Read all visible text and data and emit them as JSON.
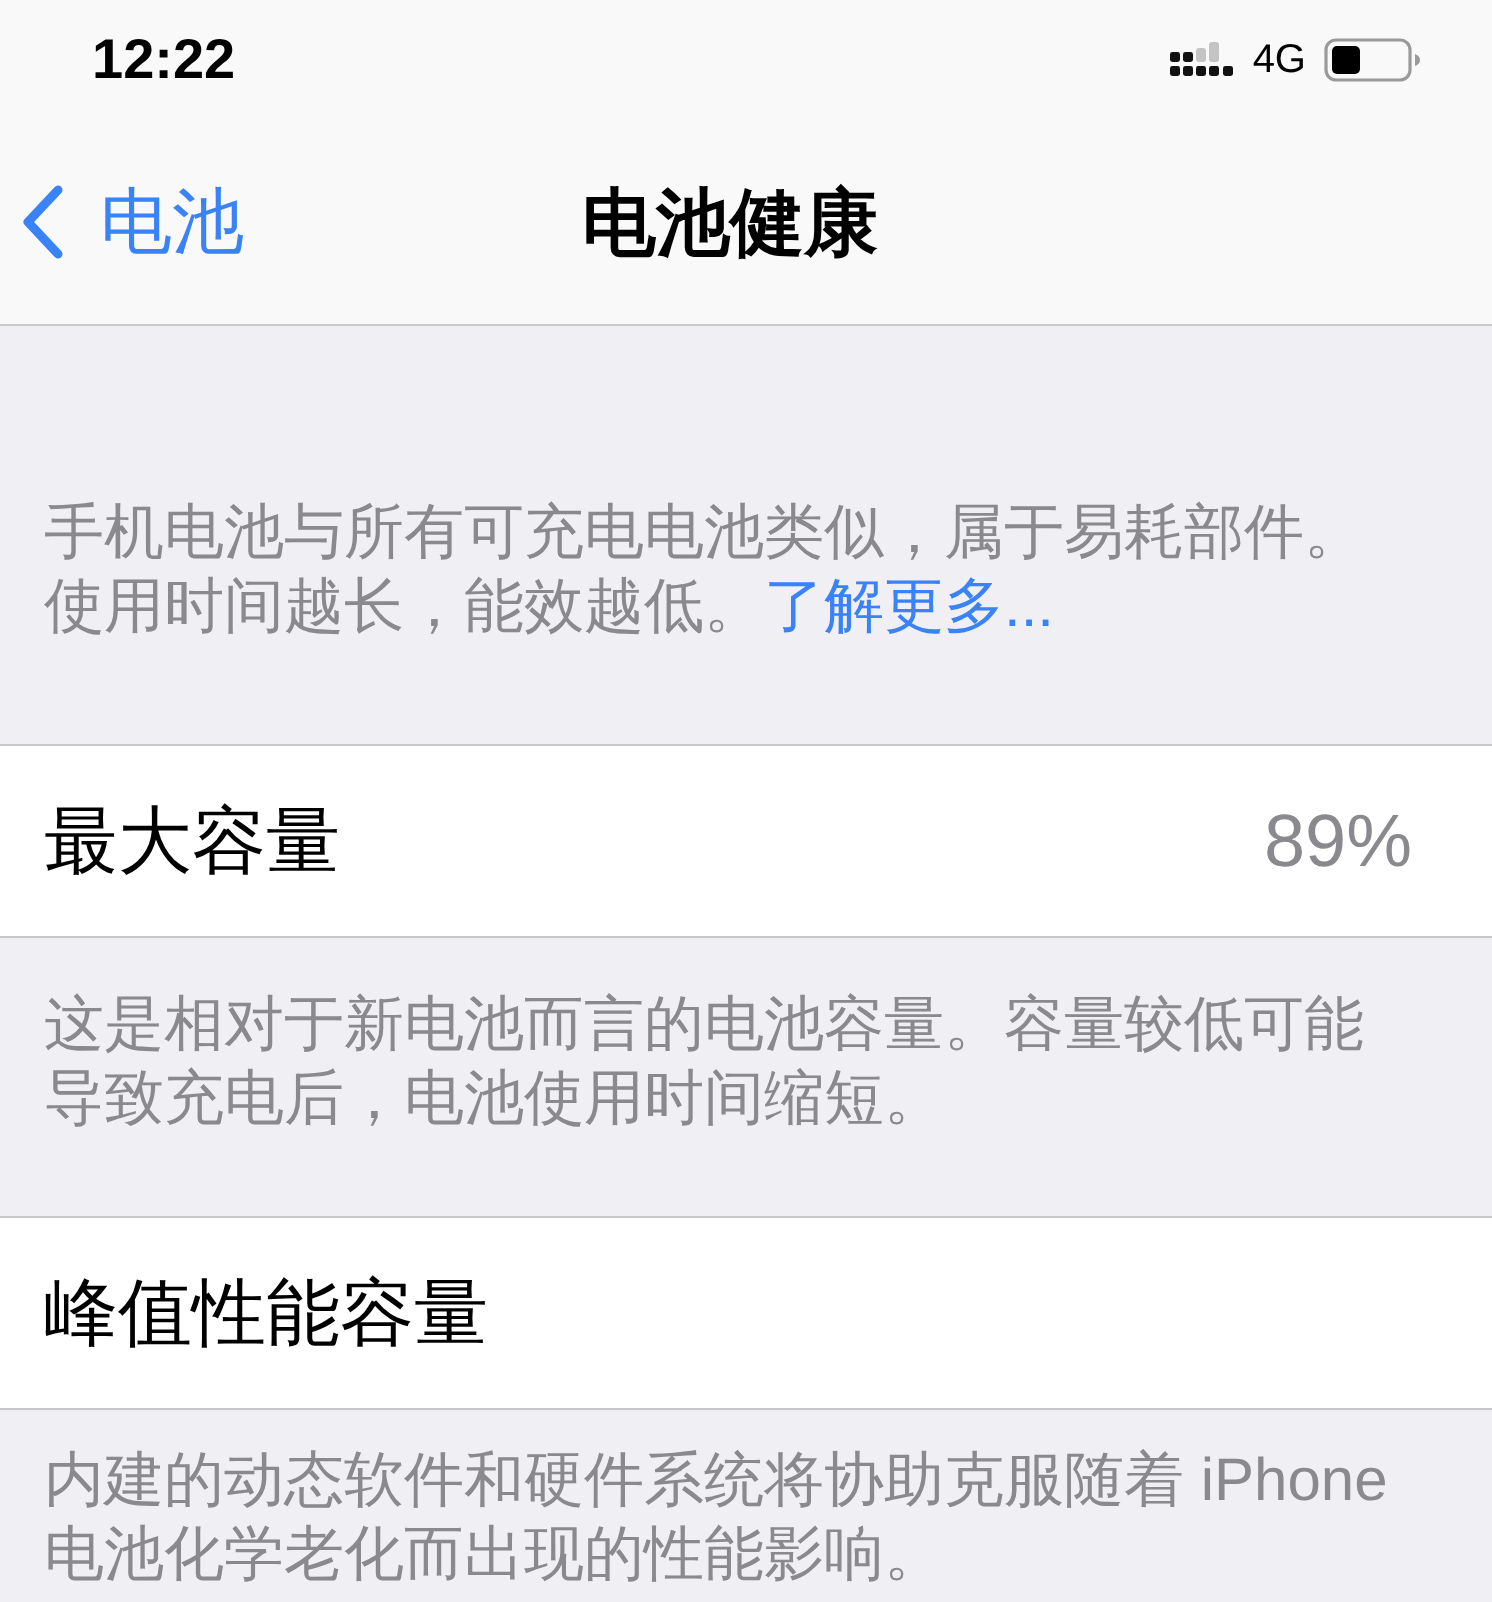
{
  "status_bar": {
    "time": "12:22",
    "network": "4G"
  },
  "nav_bar": {
    "back_label": "电池",
    "title": "电池健康"
  },
  "intro_note": {
    "text": "手机电池与所有可充电电池类似，属于易耗部件。使用时间越长，能效越低。",
    "link": "了解更多..."
  },
  "rows": [
    {
      "label": "最大容量",
      "value": "89%",
      "footer": "这是相对于新电池而言的电池容量。容量较低可能导致充电后，电池使用时间缩短。"
    },
    {
      "label": "峰值性能容量",
      "footer": "内建的动态软件和硬件系统将协助克服随着 iPhone 电池化学老化而出现的性能影响。"
    }
  ]
}
